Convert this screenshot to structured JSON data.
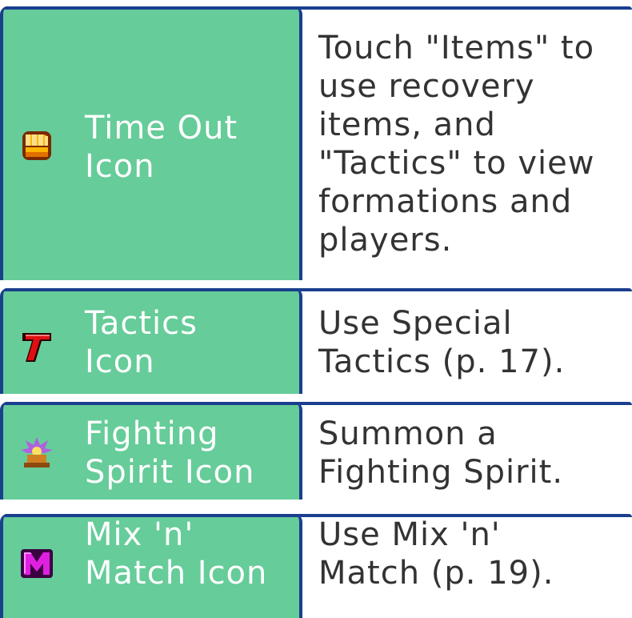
{
  "rows": [
    {
      "icon": "time-out-hand-icon",
      "label": "Time Out\nIcon",
      "description": "Touch \"Items\" to\nuse recovery\nitems, and\n\"Tactics\" to view\nformations and\nplayers."
    },
    {
      "icon": "tactics-t-icon",
      "label": "Tactics\nIcon",
      "description": "Use Special\nTactics (p. 17)."
    },
    {
      "icon": "fighting-spirit-icon",
      "label": "Fighting\nSpirit Icon",
      "description": "Summon a\nFighting Spirit."
    },
    {
      "icon": "mix-n-match-m-icon",
      "label": "Mix 'n'\nMatch Icon",
      "description": "Use Mix 'n'\nMatch (p. 19)."
    }
  ],
  "colors": {
    "label_cell_bg": "#66cc99",
    "border": "#1a3f8f",
    "label_text": "#ffffff",
    "description_text": "#333333"
  }
}
